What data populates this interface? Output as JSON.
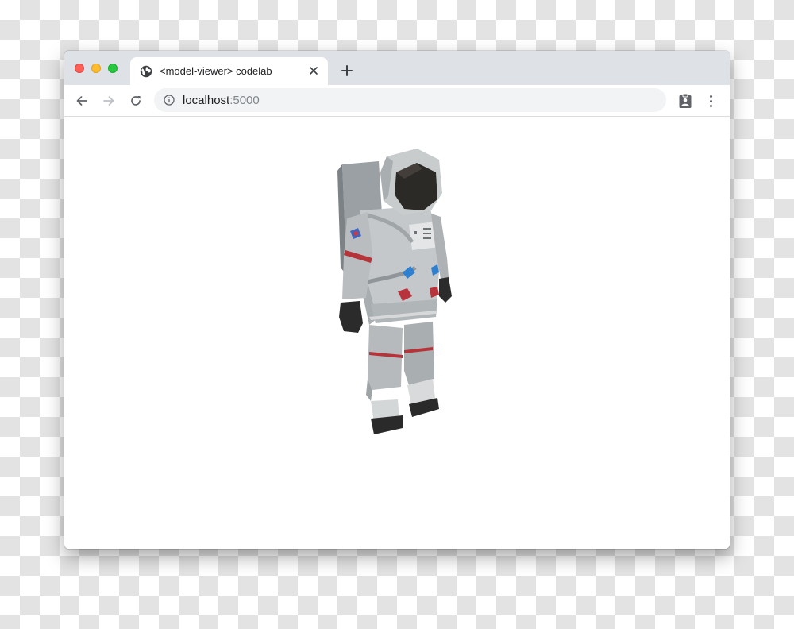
{
  "browser": {
    "tab": {
      "favicon": "globe-icon",
      "title": "<model-viewer> codelab",
      "close_icon": "close-icon"
    },
    "new_tab_icon": "plus-icon",
    "nav": {
      "back_icon": "arrow-left-icon",
      "forward_icon": "arrow-right-icon",
      "reload_icon": "reload-icon"
    },
    "address": {
      "icon": "info-icon",
      "host": "localhost",
      "port": ":5000"
    },
    "extension_icon": "clipboard-account-icon",
    "menu_icon": "kebab-menu-icon"
  },
  "page": {
    "model": "astronaut-3d-model"
  },
  "colors": {
    "titlebar": "#dee1e6",
    "close_dot": "#ff5f57",
    "minimize_dot": "#febc2e",
    "zoom_dot": "#28c840",
    "omnibox": "#f1f3f4"
  }
}
